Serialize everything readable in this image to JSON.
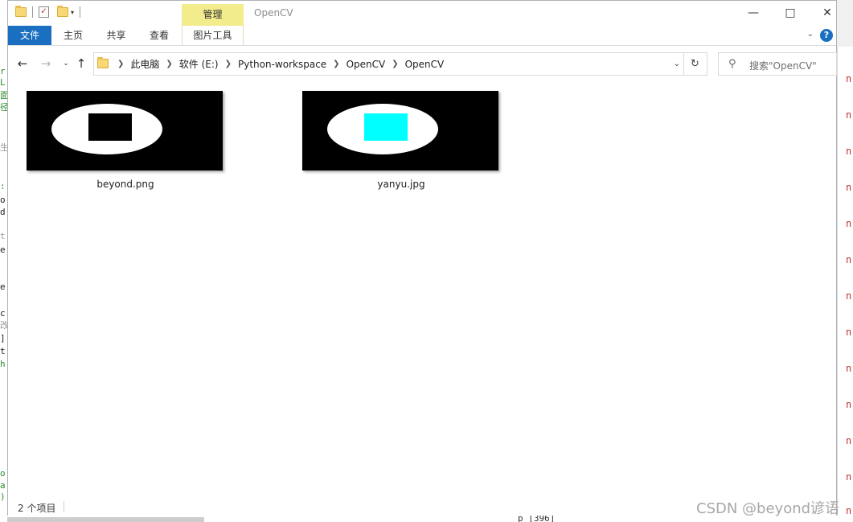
{
  "window": {
    "title": "OpenCV"
  },
  "quick_access": {
    "dropdown_label": "▾"
  },
  "ribbon": {
    "context_tab_header": "管理",
    "tabs": [
      "文件",
      "主页",
      "共享",
      "查看",
      "图片工具"
    ],
    "help_label": "?",
    "collapse_label": "⌄"
  },
  "address_bar": {
    "crumbs": [
      "此电脑",
      "软件 (E:)",
      "Python-workspace",
      "OpenCV",
      "OpenCV"
    ]
  },
  "search": {
    "placeholder": "搜索\"OpenCV\""
  },
  "files": [
    {
      "name": "beyond.png",
      "rect_color": "#000000"
    },
    {
      "name": "yanyu.jpg",
      "rect_color": "#00ffff"
    }
  ],
  "status": {
    "item_count": "2 个项目"
  },
  "watermark": "CSDN @beyond谚语",
  "background": {
    "left_glyphs": [
      "r",
      "L",
      "面",
      "径",
      "生",
      ":",
      "o",
      "d",
      "t",
      "e",
      "e",
      "c",
      "改",
      "]",
      "t",
      "h",
      "o",
      "a",
      ")"
    ],
    "right_glyphs": [
      "n",
      "n",
      "n",
      "n",
      "n",
      "n",
      "n",
      "n",
      "n",
      "n",
      "n",
      "n",
      "n"
    ],
    "bottom_code": "p [396]"
  },
  "colors": {
    "accent": "#1a6fc0",
    "context_tab": "#f2ec8c"
  }
}
